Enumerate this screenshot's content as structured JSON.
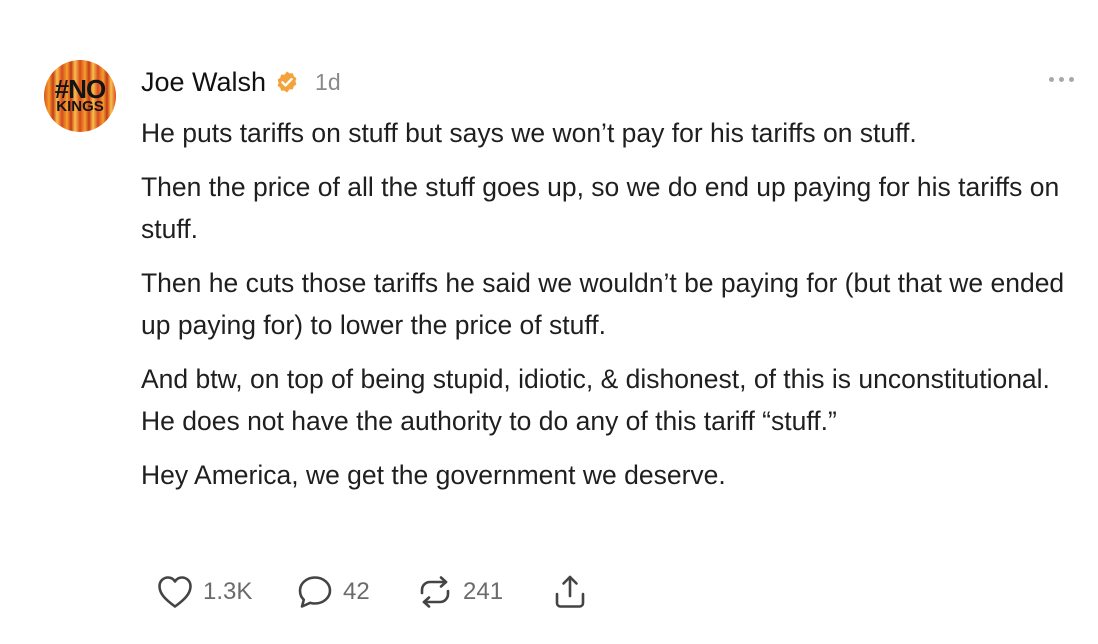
{
  "post": {
    "author": {
      "name": "Joe Walsh",
      "avatar_text_line1": "#NO",
      "avatar_text_line2": "KINGS",
      "verified": true,
      "verified_badge_color": "#f4a23b"
    },
    "time": "1d",
    "paragraphs": [
      "He puts tariffs on stuff but says we won’t pay for his tariffs on stuff.",
      "Then the price of all the stuff goes up, so we do end up paying for his tariffs on stuff.",
      "Then he cuts those tariffs he said we wouldn’t be paying for (but that we ended up paying for) to lower the price of stuff.",
      "And btw, on top of being stupid, idiotic, & dishonest, of this is unconstitutional. He does not have the authority to do any of this tariff “stuff.”",
      "Hey America, we get the government we deserve."
    ],
    "actions": {
      "like_count": "1.3K",
      "reply_count": "42",
      "repost_count": "241"
    }
  },
  "icons": {
    "more": "more-horizontal-icon",
    "like": "heart-icon",
    "reply": "comment-bubble-icon",
    "repost": "repost-icon",
    "share": "share-icon"
  }
}
